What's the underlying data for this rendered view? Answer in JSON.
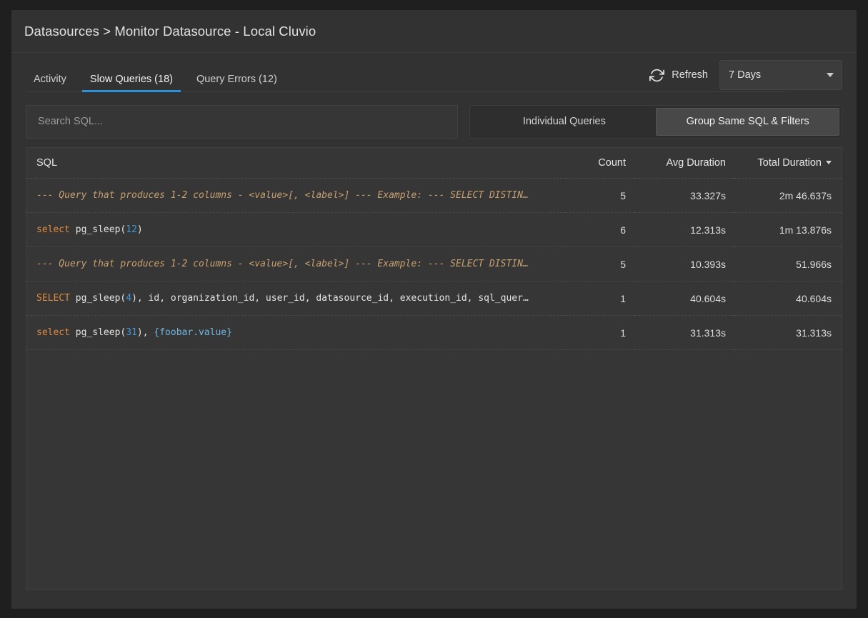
{
  "header": {
    "breadcrumb": "Datasources > Monitor Datasource - Local Cluvio",
    "breadcrumb_parts": [
      "Datasources",
      ">",
      "Monitor Datasource - Local Cluvio"
    ]
  },
  "tabs": [
    {
      "label": "Activity",
      "active": false,
      "name": "tab-activity"
    },
    {
      "label": "Slow Queries (18)",
      "active": true,
      "name": "tab-slow-queries"
    },
    {
      "label": "Query Errors (12)",
      "active": false,
      "name": "tab-query-errors"
    }
  ],
  "toolbar": {
    "refresh_label": "Refresh",
    "refresh_icon": "refresh-icon",
    "range_selected": "7 Days",
    "range_caret_icon": "chevron-down-icon"
  },
  "filters": {
    "search_placeholder": "Search SQL...",
    "search_value": "",
    "segmented": [
      {
        "label": "Individual Queries",
        "active": false,
        "name": "segment-individual-queries"
      },
      {
        "label": "Group Same SQL & Filters",
        "active": true,
        "name": "segment-group-same-sql"
      }
    ]
  },
  "table": {
    "columns": {
      "sql": "SQL",
      "count": "Count",
      "avg_duration": "Avg Duration",
      "total_duration": "Total Duration"
    },
    "sort": {
      "column": "Total Duration",
      "direction": "desc",
      "icon": "chevron-down-icon"
    },
    "rows": [
      {
        "sql_text": "--- Query that produces 1-2 columns - <value>[, <label>] --- Example: --- SELECT DISTIN…",
        "sql_tokens": [
          {
            "t": "comment",
            "v": "--- Query that produces 1-2 columns - <value>[, <label>] --- Example: --- SELECT DISTIN…"
          }
        ],
        "count": "5",
        "avg_duration": "33.327s",
        "total_duration": "2m 46.637s"
      },
      {
        "sql_text": "select pg_sleep(12)",
        "sql_tokens": [
          {
            "t": "keyword",
            "v": "select"
          },
          {
            "t": "plain",
            "v": " pg_sleep("
          },
          {
            "t": "number",
            "v": "12"
          },
          {
            "t": "plain",
            "v": ")"
          }
        ],
        "count": "6",
        "avg_duration": "12.313s",
        "total_duration": "1m 13.876s"
      },
      {
        "sql_text": "--- Query that produces 1-2 columns - <value>[, <label>] --- Example: --- SELECT DISTIN…",
        "sql_tokens": [
          {
            "t": "comment",
            "v": "--- Query that produces 1-2 columns - <value>[, <label>] --- Example: --- SELECT DISTIN…"
          }
        ],
        "count": "5",
        "avg_duration": "10.393s",
        "total_duration": "51.966s"
      },
      {
        "sql_text": "SELECT pg_sleep(4), id, organization_id, user_id, datasource_id, execution_id, sql_quer…",
        "sql_tokens": [
          {
            "t": "keyword",
            "v": "SELECT"
          },
          {
            "t": "plain",
            "v": " pg_sleep("
          },
          {
            "t": "number",
            "v": "4"
          },
          {
            "t": "plain",
            "v": "), id, organization_id, user_id, datasource_id, execution_id, sql_quer…"
          }
        ],
        "count": "1",
        "avg_duration": "40.604s",
        "total_duration": "40.604s"
      },
      {
        "sql_text": "select pg_sleep(31), {foobar.value}",
        "sql_tokens": [
          {
            "t": "keyword",
            "v": "select"
          },
          {
            "t": "plain",
            "v": " pg_sleep("
          },
          {
            "t": "number",
            "v": "31"
          },
          {
            "t": "plain",
            "v": "), "
          },
          {
            "t": "var",
            "v": "{foobar.value}"
          }
        ],
        "count": "1",
        "avg_duration": "31.313s",
        "total_duration": "31.313s"
      }
    ]
  },
  "colors": {
    "accent": "#2e90d6",
    "panel": "#323232",
    "page": "#1f1f1f",
    "keyword": "#e08a3c",
    "comment": "#c8a070",
    "number": "#3d9ad8",
    "variable": "#6fb8e0"
  }
}
